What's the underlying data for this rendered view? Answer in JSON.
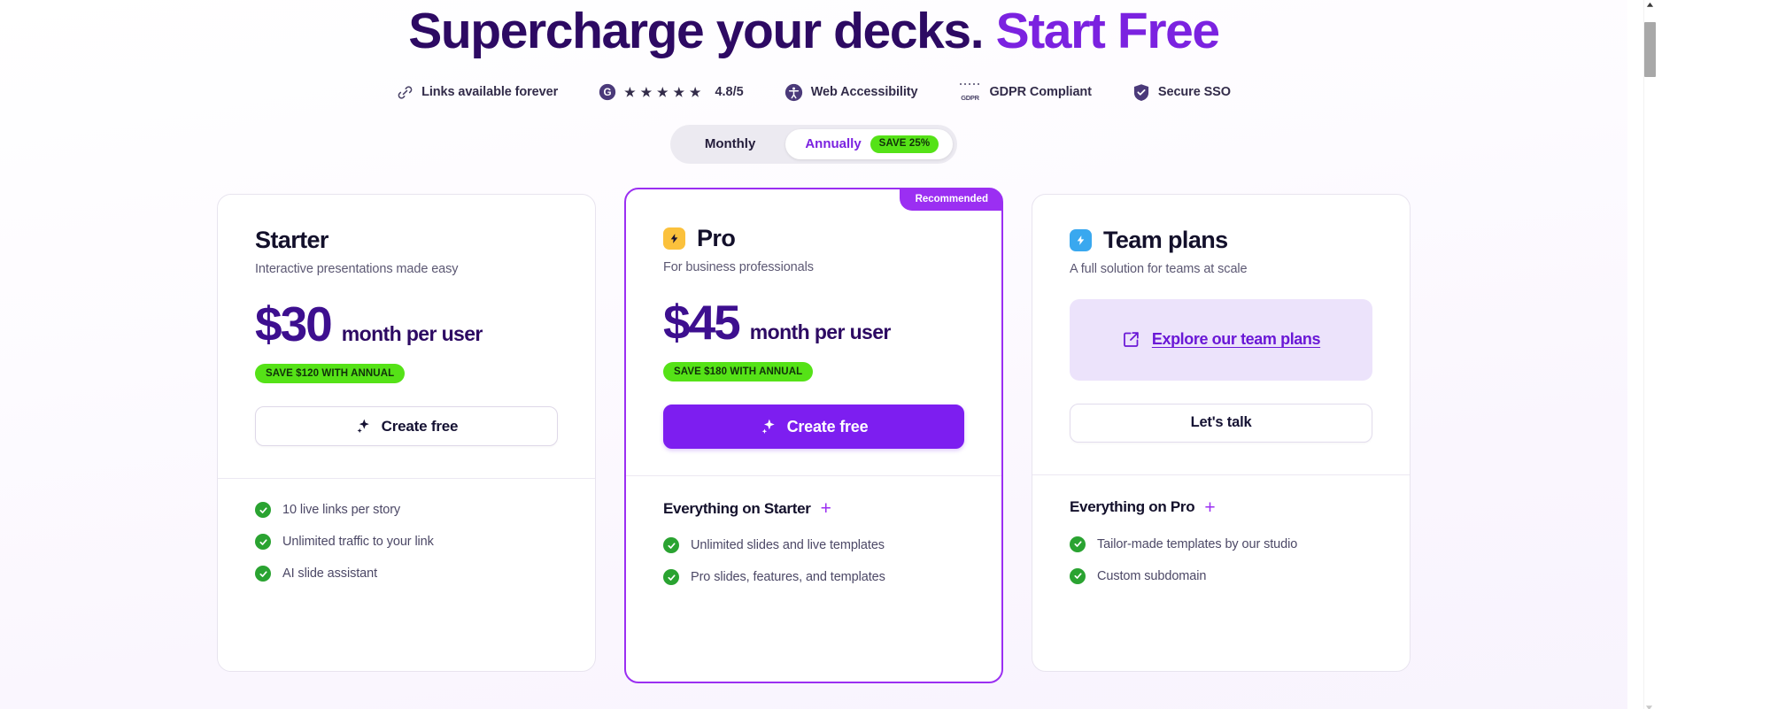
{
  "hero": {
    "title_main": "Supercharge your decks.",
    "title_accent": "Start Free"
  },
  "trust_badges": [
    {
      "icon": "link-icon",
      "label": "Links available forever"
    },
    {
      "icon": "g2-icon",
      "label": "",
      "stars": "★ ★ ★ ★ ★",
      "rating": "4.8/5"
    },
    {
      "icon": "accessibility-icon",
      "label": "Web Accessibility"
    },
    {
      "icon": "gdpr-icon",
      "label": "GDPR Compliant",
      "badge_text": "GDPR"
    },
    {
      "icon": "shield-check-icon",
      "label": "Secure SSO"
    }
  ],
  "billing_toggle": {
    "monthly_label": "Monthly",
    "annually_label": "Annually",
    "save_badge": "SAVE 25%",
    "selected": "Annually"
  },
  "plans": [
    {
      "name": "Starter",
      "subtitle": "Interactive presentations made easy",
      "price": "$30",
      "price_unit": "month per user",
      "annual_badge": "SAVE $120 WITH ANNUAL",
      "cta_label": "Create free",
      "cta_icon": "sparkle-icon",
      "features": [
        "10 live links per story",
        "Unlimited traffic to your link",
        "AI slide assistant"
      ]
    },
    {
      "name": "Pro",
      "subtitle": "For business professionals",
      "ribbon": "Recommended",
      "badge_icon": "lightning-icon",
      "price": "$45",
      "price_unit": "month per user",
      "annual_badge": "SAVE $180 WITH ANNUAL",
      "cta_label": "Create free",
      "cta_icon": "sparkle-icon",
      "features_heading": "Everything on Starter",
      "features": [
        "Unlimited slides and live templates",
        "Pro slides, features, and templates"
      ]
    },
    {
      "name": "Team plans",
      "subtitle": "A full solution for teams at scale",
      "badge_icon": "lightning-icon",
      "link_label": "Explore our team plans",
      "link_icon": "external-link-icon",
      "cta_label": "Let's talk",
      "features_heading": "Everything on Pro",
      "features": [
        "Tailor-made templates by our studio",
        "Custom subdomain"
      ]
    }
  ],
  "colors": {
    "accent_purple": "#7b22e0",
    "heading_navy": "#2d0a63",
    "green_badge": "#55e217",
    "check_green": "#2aa331",
    "pro_border": "#9b2ff2",
    "amber": "#fbc13c",
    "blue": "#39a8ef"
  }
}
